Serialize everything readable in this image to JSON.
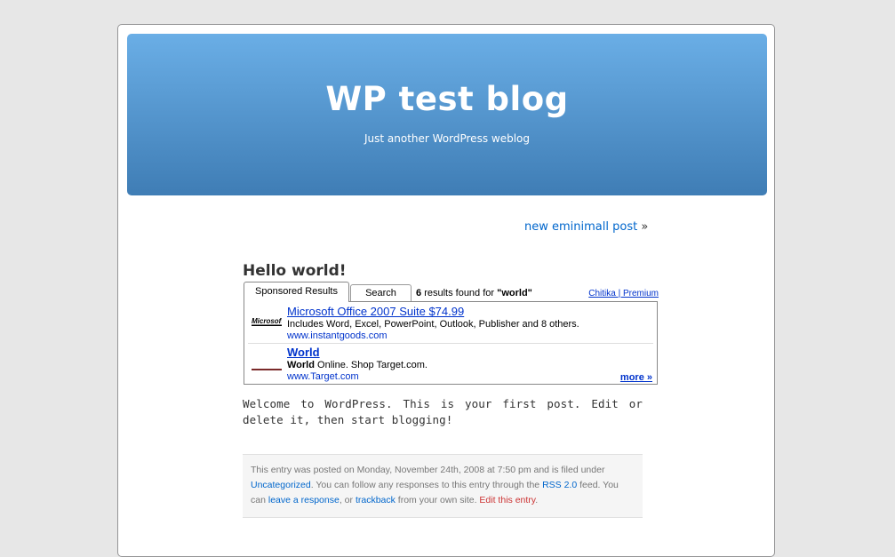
{
  "header": {
    "title": "WP test blog",
    "description": "Just another WordPress weblog"
  },
  "navigation": {
    "next_label": "new eminimall post",
    "next_arrow": "»"
  },
  "post": {
    "title": "Hello world!",
    "body": "Welcome to WordPress. This is your first post. Edit or delete it, then start blogging!"
  },
  "ad": {
    "tabs": [
      "Sponsored Results",
      "Search"
    ],
    "count": "6",
    "count_text": "results found for",
    "query": "\"world\"",
    "provider": "Chitika | Premium",
    "items": [
      {
        "logo": "microsoft-logo",
        "title": "Microsoft Office 2007 Suite $74.99",
        "desc": "Includes Word, Excel, PowerPoint, Outlook, Publisher and 8 others.",
        "url": "www.instantgoods.com"
      },
      {
        "logo": "target-logo",
        "title": "World",
        "desc_bold": "World",
        "desc": " Online. Shop Target.com.",
        "url": "www.Target.com"
      }
    ],
    "more": "more »"
  },
  "meta": {
    "part1": "This entry was posted on Monday, November 24th, 2008 at 7:50 pm and is filed under",
    "category": "Uncategorized",
    "part2": ". You can follow any responses to this entry through the",
    "rss": "RSS 2.0",
    "part3": "feed. You can",
    "leave_response": "leave a response",
    "part4": ", or",
    "trackback": "trackback",
    "part5": "from your own site.",
    "edit": "Edit this entry",
    "part6": "."
  }
}
